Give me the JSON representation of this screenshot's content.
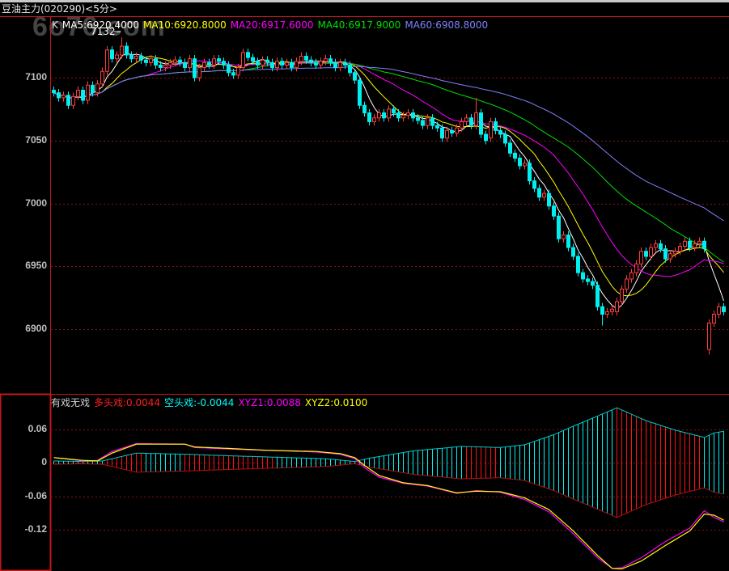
{
  "header": {
    "title": "豆油主力(020290)<5分>",
    "watermark": "6o76.com"
  },
  "main_legend": [
    {
      "label": "K",
      "color": "#e0e0e0"
    },
    {
      "label": "MA5:6920.4000",
      "color": "#ffffff"
    },
    {
      "label": "MA10:6920.8000",
      "color": "#ffff00"
    },
    {
      "label": "MA20:6917.6000",
      "color": "#ff00ff"
    },
    {
      "label": "MA40:6917.9000",
      "color": "#00e000"
    },
    {
      "label": "MA60:6908.8000",
      "color": "#8080ff"
    }
  ],
  "indicator_legend": [
    {
      "label": "有戏无戏",
      "color": "#d0d0d0"
    },
    {
      "label": "多头戏:0.0044",
      "color": "#ff2020"
    },
    {
      "label": "空头戏:-0.0044",
      "color": "#00ffff"
    },
    {
      "label": "XYZ1:0.0088",
      "color": "#ff00ff"
    },
    {
      "label": "XYZ2:0.0100",
      "color": "#ffff00"
    }
  ],
  "colors": {
    "up": "#ff3c3c",
    "down": "#00f0f0",
    "flat": "#ffffff",
    "grid": "#8a1010",
    "border": "#c01818"
  },
  "chart_data": [
    {
      "type": "candlestick",
      "title": "豆油主力(020290)<5分>",
      "y_ticks": [
        "7100",
        "7050",
        "7000",
        "6950",
        "6900"
      ],
      "y_tick_values": [
        7100,
        7050,
        7000,
        6950,
        6900
      ],
      "ylim": [
        6870,
        7150
      ],
      "high_label": "7132",
      "high_label_index": 14,
      "first_open": 7090,
      "close": [
        7088,
        7084,
        7086,
        7078,
        7085,
        7090,
        7082,
        7094,
        7088,
        7095,
        7105,
        7122,
        7115,
        7118,
        7125,
        7118,
        7115,
        7117,
        7114,
        7112,
        7115,
        7110,
        7108,
        7110,
        7112,
        7114,
        7112,
        7108,
        7115,
        7100,
        7108,
        7112,
        7110,
        7115,
        7113,
        7110,
        7104,
        7102,
        7108,
        7120,
        7116,
        7113,
        7110,
        7114,
        7112,
        7108,
        7113,
        7110,
        7112,
        7108,
        7113,
        7117,
        7114,
        7112,
        7110,
        7113,
        7115,
        7112,
        7108,
        7112,
        7110,
        7104,
        7098,
        7078,
        7072,
        7065,
        7068,
        7072,
        7068,
        7075,
        7072,
        7068,
        7070,
        7072,
        7068,
        7066,
        7062,
        7068,
        7062,
        7060,
        7052,
        7058,
        7056,
        7060,
        7065,
        7068,
        7062,
        7072,
        7055,
        7050,
        7065,
        7058,
        7055,
        7048,
        7040,
        7036,
        7030,
        7032,
        7018,
        7012,
        7005,
        7008,
        6998,
        6990,
        6972,
        6975,
        6965,
        6958,
        6945,
        6940,
        6938,
        6935,
        6918,
        6912,
        6914,
        6916,
        6922,
        6932,
        6940,
        6945,
        6952,
        6962,
        6958,
        6965,
        6968,
        6964,
        6956,
        6960,
        6962,
        6966,
        6970,
        6965,
        6968,
        6970,
        6964,
        6905,
        6912,
        6918,
        6914
      ],
      "open_overrides": {
        "135": 6884,
        "90": 7052,
        "116": 6914
      },
      "high_overrides": {
        "14": 7132,
        "87": 7084
      },
      "low_overrides": {
        "135": 6880,
        "113": 6903
      },
      "ma_periods": [
        5,
        10,
        20,
        40,
        60
      ]
    },
    {
      "type": "indicator",
      "name": "有戏无戏",
      "y_ticks": [
        "0.06",
        "0",
        "-0.06",
        "-0.12"
      ],
      "y_tick_values": [
        0.06,
        0,
        -0.06,
        -0.12
      ],
      "amplitude_keypoints": [
        [
          0,
          0.003
        ],
        [
          6,
          0.002
        ],
        [
          10,
          0.003
        ],
        [
          17,
          0.017
        ],
        [
          27,
          0.015
        ],
        [
          37,
          0.012
        ],
        [
          56,
          0.007
        ],
        [
          62,
          0.002
        ],
        [
          65,
          0.008
        ],
        [
          74,
          0.021
        ],
        [
          84,
          0.029
        ],
        [
          92,
          0.027
        ],
        [
          97,
          0.032
        ],
        [
          103,
          0.05
        ],
        [
          107,
          0.065
        ],
        [
          116,
          0.098
        ],
        [
          122,
          0.075
        ],
        [
          128,
          0.058
        ],
        [
          134,
          0.045
        ],
        [
          136,
          0.053
        ],
        [
          138,
          0.056
        ]
      ],
      "bar_color_runs": [
        {
          "from": 0,
          "to": 10,
          "side": "bear"
        },
        {
          "from": 11,
          "to": 18,
          "side": "bull"
        },
        {
          "from": 19,
          "to": 26,
          "side": "bear"
        },
        {
          "from": 27,
          "to": 45,
          "side": "bull"
        },
        {
          "from": 46,
          "to": 84,
          "side": "bear"
        },
        {
          "from": 85,
          "to": 91,
          "side": "bull"
        },
        {
          "from": 92,
          "to": 115,
          "side": "bear"
        },
        {
          "from": 116,
          "to": 133,
          "side": "bull"
        },
        {
          "from": 134,
          "to": 138,
          "side": "bear"
        }
      ],
      "xyz1_keypoints": [
        [
          0,
          0.009
        ],
        [
          6,
          0.003
        ],
        [
          9,
          0.004
        ],
        [
          12,
          0.02
        ],
        [
          17,
          0.034
        ],
        [
          27,
          0.033
        ],
        [
          29,
          0.027
        ],
        [
          37,
          0.024
        ],
        [
          44,
          0.022
        ],
        [
          54,
          0.019
        ],
        [
          59,
          0.015
        ],
        [
          62,
          0.007
        ],
        [
          64,
          -0.009
        ],
        [
          67,
          -0.026
        ],
        [
          72,
          -0.037
        ],
        [
          77,
          -0.042
        ],
        [
          83,
          -0.055
        ],
        [
          87,
          -0.05
        ],
        [
          92,
          -0.053
        ],
        [
          97,
          -0.066
        ],
        [
          102,
          -0.088
        ],
        [
          107,
          -0.127
        ],
        [
          112,
          -0.17
        ],
        [
          115,
          -0.189
        ],
        [
          117,
          -0.188
        ],
        [
          121,
          -0.17
        ],
        [
          126,
          -0.141
        ],
        [
          131,
          -0.117
        ],
        [
          134,
          -0.086
        ],
        [
          136,
          -0.098
        ],
        [
          138,
          -0.106
        ]
      ],
      "xyz2_keypoints": [
        [
          0,
          0.009
        ],
        [
          6,
          0.004
        ],
        [
          9,
          0.003
        ],
        [
          12,
          0.017
        ],
        [
          17,
          0.033
        ],
        [
          27,
          0.033
        ],
        [
          29,
          0.028
        ],
        [
          37,
          0.025
        ],
        [
          44,
          0.022
        ],
        [
          54,
          0.02
        ],
        [
          59,
          0.016
        ],
        [
          62,
          0.009
        ],
        [
          64,
          -0.005
        ],
        [
          67,
          -0.023
        ],
        [
          72,
          -0.036
        ],
        [
          77,
          -0.041
        ],
        [
          83,
          -0.054
        ],
        [
          87,
          -0.051
        ],
        [
          92,
          -0.052
        ],
        [
          97,
          -0.063
        ],
        [
          102,
          -0.084
        ],
        [
          107,
          -0.122
        ],
        [
          112,
          -0.166
        ],
        [
          115,
          -0.189
        ],
        [
          117,
          -0.19
        ],
        [
          121,
          -0.176
        ],
        [
          126,
          -0.148
        ],
        [
          131,
          -0.122
        ],
        [
          134,
          -0.092
        ],
        [
          136,
          -0.094
        ],
        [
          138,
          -0.103
        ]
      ],
      "ylim": [
        -0.2,
        0.12
      ]
    }
  ]
}
